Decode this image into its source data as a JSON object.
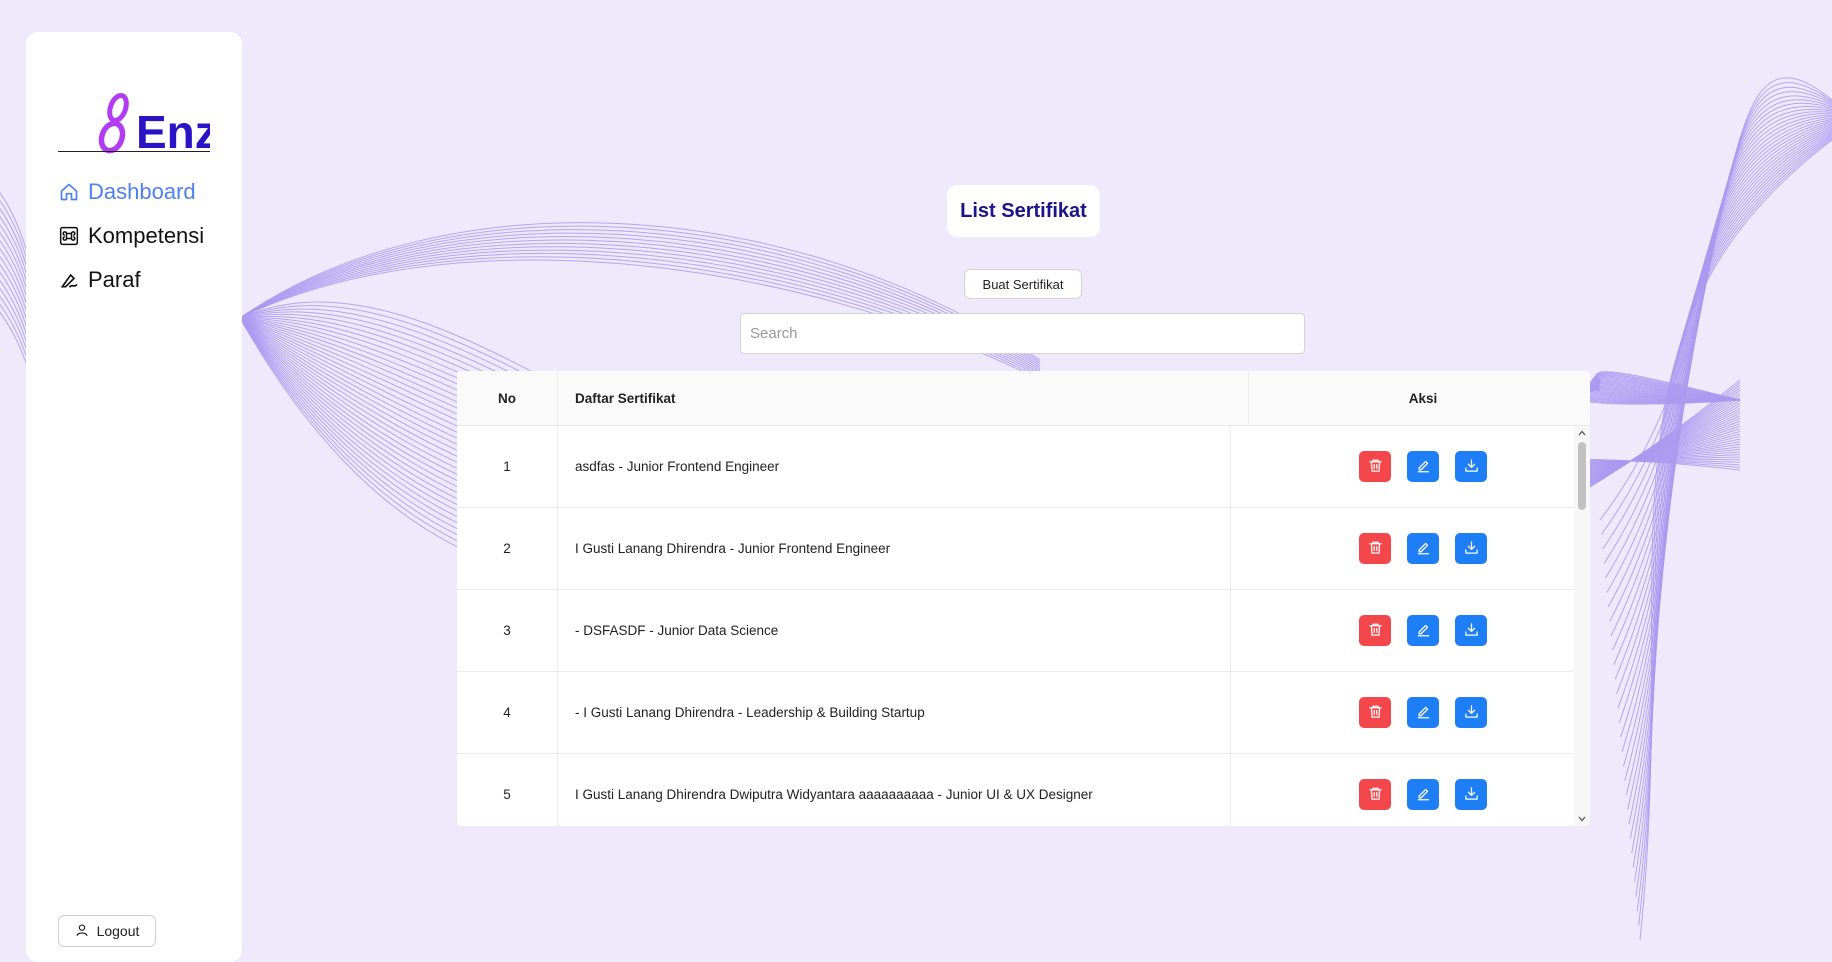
{
  "app": {
    "logo_text": "Enz",
    "brand_color": "#2a12c7",
    "logo_accent": "#b13cf2"
  },
  "sidebar": {
    "items": [
      {
        "label": "Dashboard",
        "icon": "home-icon",
        "active": true
      },
      {
        "label": "Kompetensi",
        "icon": "command-icon",
        "active": false
      },
      {
        "label": "Paraf",
        "icon": "signature-icon",
        "active": false
      }
    ],
    "logout_label": "Logout",
    "logout_icon": "user-icon"
  },
  "main": {
    "title": "List Sertifikat",
    "create_button_label": "Buat Sertifikat",
    "search_placeholder": "Search",
    "search_value": ""
  },
  "table": {
    "columns": [
      "No",
      "Daftar Sertifikat",
      "Aksi"
    ],
    "rows": [
      {
        "no": "1",
        "name": "asdfas - Junior Frontend Engineer"
      },
      {
        "no": "2",
        "name": "I Gusti Lanang Dhirendra - Junior Frontend Engineer"
      },
      {
        "no": "3",
        "name": "- DSFASDF - Junior Data Science"
      },
      {
        "no": "4",
        "name": "- I Gusti Lanang Dhirendra - Leadership & Building Startup"
      },
      {
        "no": "5",
        "name": "I Gusti Lanang Dhirendra Dwiputra Widyantara aaaaaaaaaa - Junior UI & UX Designer"
      }
    ],
    "actions": [
      {
        "icon": "trash-icon",
        "color": "#f4474c"
      },
      {
        "icon": "edit-icon",
        "color": "#1e7ef6"
      },
      {
        "icon": "download-icon",
        "color": "#1e7ef6"
      }
    ]
  },
  "colors": {
    "background": "#eeeafc",
    "active_nav": "#4f80f0",
    "title_text": "#1a1488",
    "wave_lines": "#a99af0"
  }
}
